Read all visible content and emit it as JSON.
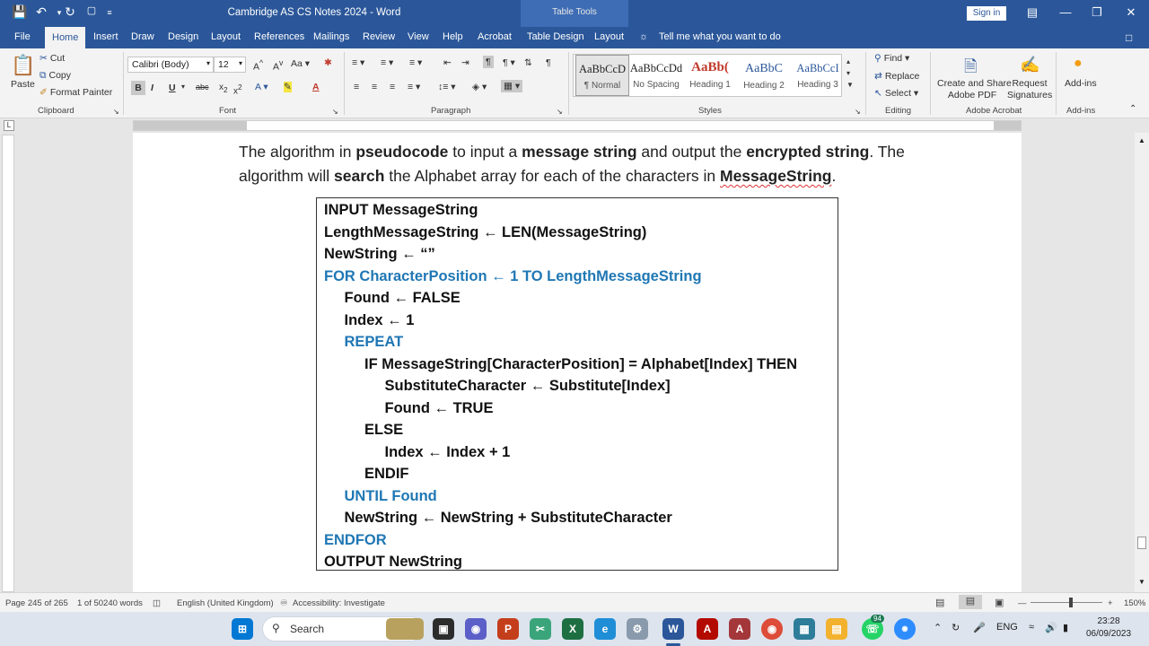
{
  "window": {
    "title": "Cambridge AS CS Notes 2024  -  Word",
    "table_tools": "Table Tools",
    "sign_in": "Sign in"
  },
  "tabs": [
    "File",
    "Home",
    "Insert",
    "Draw",
    "Design",
    "Layout",
    "References",
    "Mailings",
    "Review",
    "View",
    "Help",
    "Acrobat",
    "Table Design",
    "Layout"
  ],
  "tell_me": "Tell me what you want to do",
  "clipboard": {
    "paste": "Paste",
    "cut": "Cut",
    "copy": "Copy",
    "format_painter": "Format Painter",
    "label": "Clipboard"
  },
  "font": {
    "family": "Calibri (Body)",
    "size": "12",
    "label": "Font"
  },
  "paragraph": {
    "label": "Paragraph"
  },
  "styles": {
    "items": [
      {
        "sample": "AaBbCcD",
        "name": "¶ Normal"
      },
      {
        "sample": "AaBbCcDd",
        "name": "No Spacing"
      },
      {
        "sample": "AaBb(",
        "name": "Heading 1"
      },
      {
        "sample": "AaBbC",
        "name": "Heading 2"
      },
      {
        "sample": "AaBbCcI",
        "name": "Heading 3"
      }
    ],
    "label": "Styles"
  },
  "editing": {
    "find": "Find",
    "replace": "Replace",
    "select": "Select",
    "label": "Editing"
  },
  "acrobat": {
    "create": "Create and Share",
    "create2": "Adobe PDF",
    "request": "Request",
    "request2": "Signatures",
    "label": "Adobe Acrobat"
  },
  "addins": {
    "button": "Add-ins",
    "label": "Add-ins"
  },
  "document": {
    "para": {
      "p1": "The algorithm in ",
      "b1": "pseudocode",
      "p2": " to input a ",
      "b2": "message string",
      "p3": " and output the ",
      "b3": "encrypted string",
      "p4": ". The algorithm will ",
      "b4": "search",
      "p5": " the Alphabet array for each of the characters in ",
      "b5": "MessageString",
      "p6": "."
    },
    "code_lines": [
      {
        "text": "INPUT MessageString",
        "indent": 0,
        "blue": false
      },
      {
        "text": "LengthMessageString ← LEN(MessageString)",
        "indent": 0,
        "blue": false
      },
      {
        "text": "NewString ← “”",
        "indent": 0,
        "blue": false
      },
      {
        "text": "FOR CharacterPosition ← 1 TO LengthMessageString",
        "indent": 0,
        "blue": true
      },
      {
        "text": "Found ← FALSE",
        "indent": 1,
        "blue": false
      },
      {
        "text": "Index ← 1",
        "indent": 1,
        "blue": false
      },
      {
        "text": "REPEAT",
        "indent": 1,
        "blue": true
      },
      {
        "text": "IF MessageString[CharacterPosition] = Alphabet[Index] THEN",
        "indent": 2,
        "blue": false
      },
      {
        "text": "SubstituteCharacter ← Substitute[Index]",
        "indent": 3,
        "blue": false
      },
      {
        "text": "Found ← TRUE",
        "indent": 3,
        "blue": false
      },
      {
        "text": "ELSE",
        "indent": 2,
        "blue": false
      },
      {
        "text": "Index ← Index + 1",
        "indent": 3,
        "blue": false
      },
      {
        "text": "ENDIF",
        "indent": 2,
        "blue": false
      },
      {
        "text": "UNTIL Found",
        "indent": 1,
        "blue": true
      },
      {
        "text": "NewString ← NewString + SubstituteCharacter",
        "indent": 1,
        "blue": false
      },
      {
        "text": "ENDFOR",
        "indent": 0,
        "blue": true
      },
      {
        "text": "OUTPUT NewString",
        "indent": 0,
        "blue": false
      }
    ]
  },
  "status": {
    "page": "Page 245 of 265",
    "words": "1 of 50240 words",
    "language": "English (United Kingdom)",
    "accessibility": "Accessibility: Investigate",
    "zoom": "150%"
  },
  "taskbar": {
    "search": "Search",
    "badge": "94",
    "lang": "ENG",
    "time": "23:28",
    "date": "06/09/2023"
  },
  "colors": {
    "word_blue": "#2b579a",
    "keyword_blue": "#1f77b4"
  }
}
